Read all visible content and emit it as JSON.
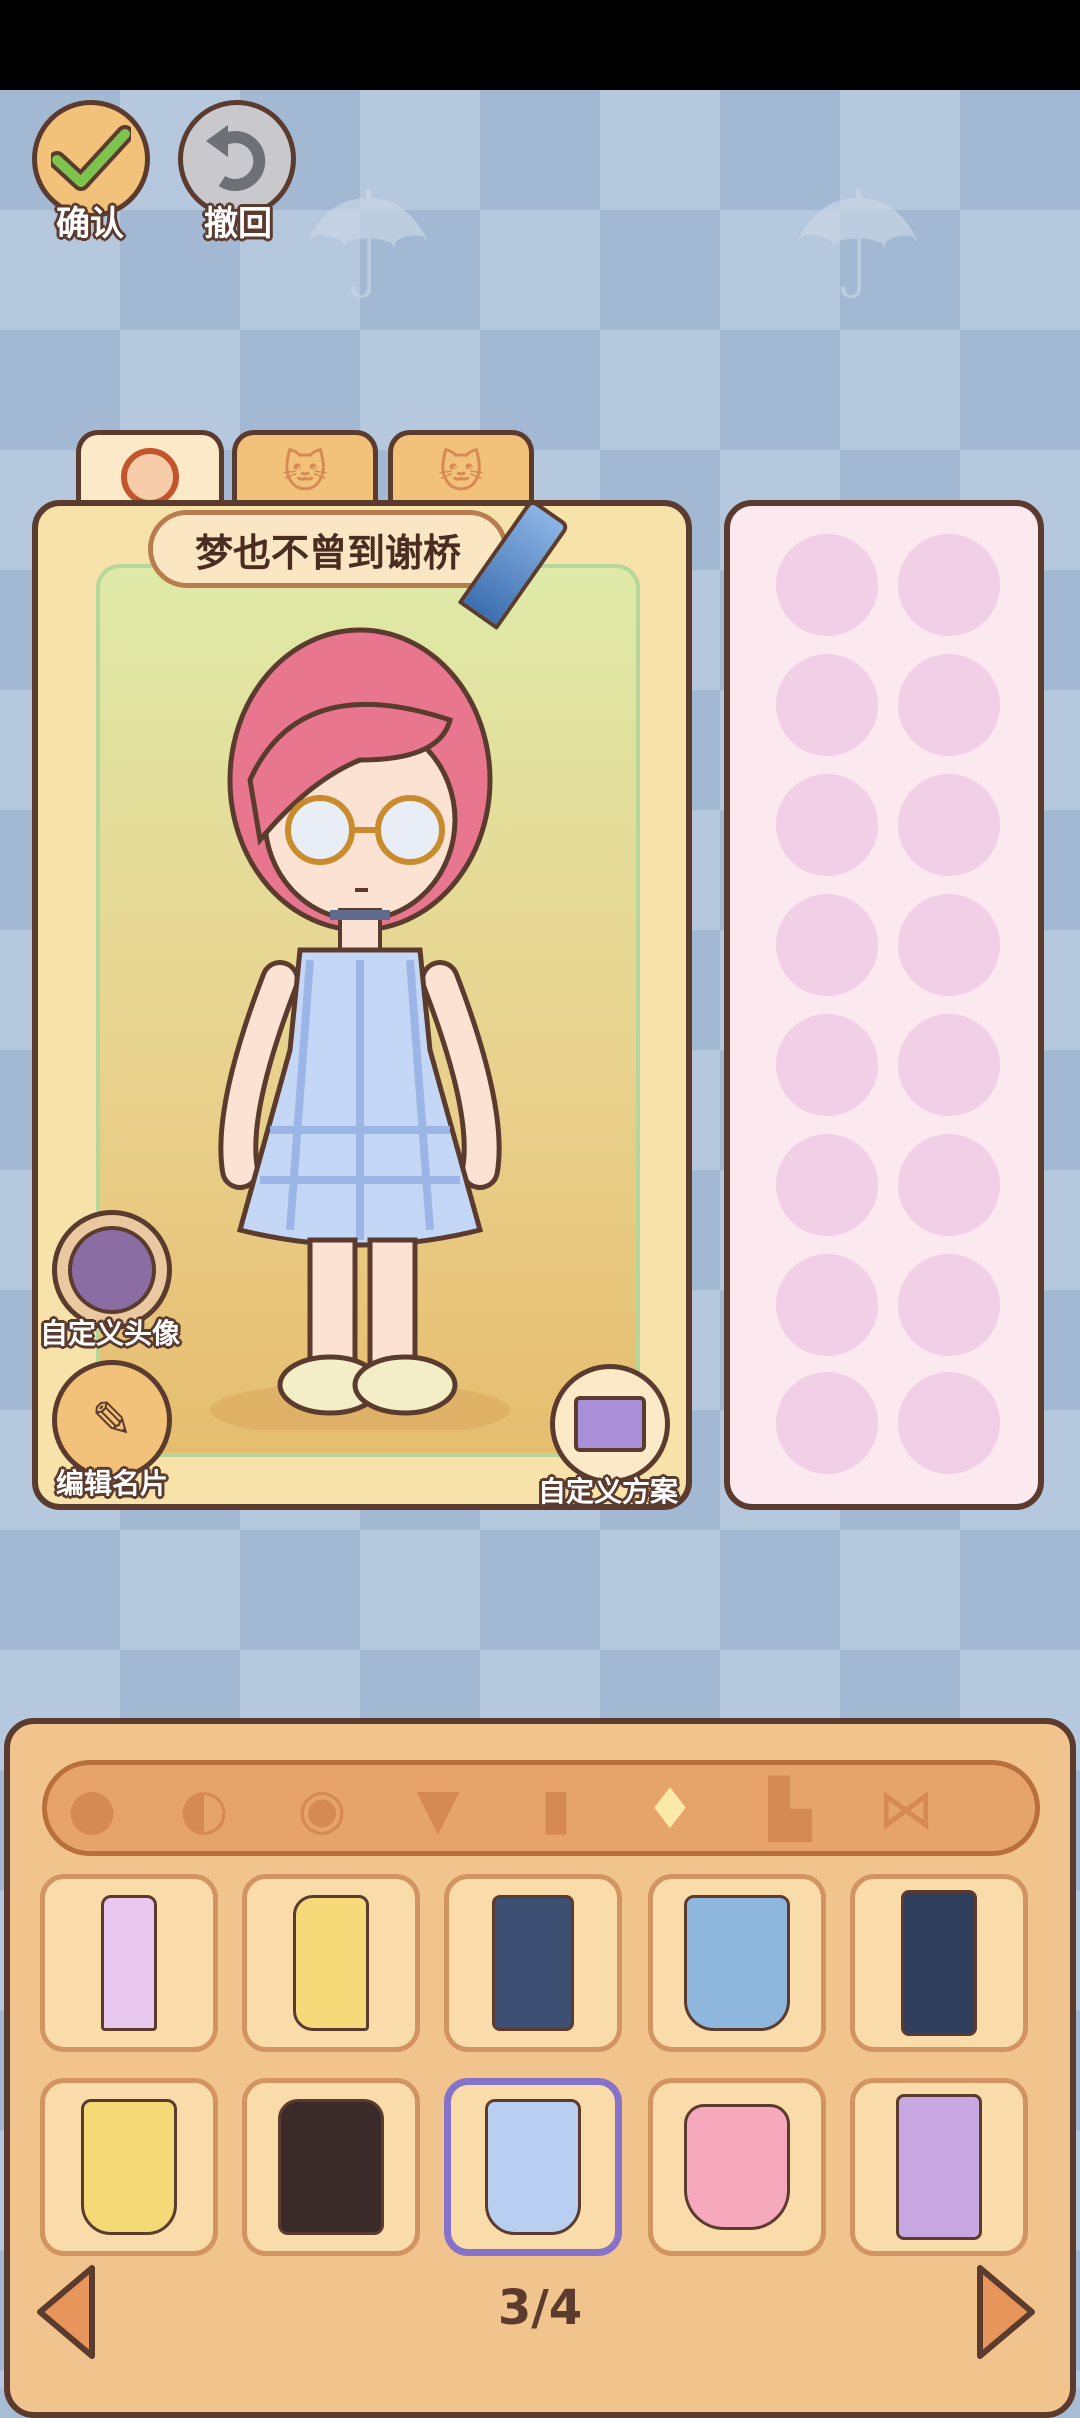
{
  "top_buttons": {
    "confirm_label": "确认",
    "undo_label": "撤回"
  },
  "profile_tabs": [
    {
      "icon": "girl-face-icon"
    },
    {
      "icon": "cat-face-icon"
    },
    {
      "icon": "cat-face-outline-icon"
    }
  ],
  "character": {
    "name": "梦也不曾到谢桥"
  },
  "card_actions": {
    "custom_avatar_label": "自定义头像",
    "edit_card_label": "编辑名片",
    "custom_scheme_label": "自定义方案"
  },
  "categories": [
    {
      "icon": "face-icon"
    },
    {
      "icon": "hair-icon"
    },
    {
      "icon": "eye-icon"
    },
    {
      "icon": "top-icon"
    },
    {
      "icon": "coat-icon"
    },
    {
      "icon": "outfit-icon",
      "active": true
    },
    {
      "icon": "shoe-icon"
    },
    {
      "icon": "bow-icon"
    }
  ],
  "items": [
    {
      "name": "purple-qipao",
      "color": "#e8c8ee"
    },
    {
      "name": "yellow-gown",
      "color": "#f6d979"
    },
    {
      "name": "navy-overalls",
      "color": "#3e4f74"
    },
    {
      "name": "denim-dress",
      "color": "#8fb7de"
    },
    {
      "name": "overall-pants",
      "color": "#2f3e5c"
    },
    {
      "name": "yellow-gingham-dress",
      "color": "#f4d977"
    },
    {
      "name": "black-dress",
      "color": "#3a2a2a"
    },
    {
      "name": "blue-gingham-dress",
      "color": "#b9cff2",
      "selected": true
    },
    {
      "name": "pink-dress",
      "color": "#f6a9bd"
    },
    {
      "name": "lavender-robe",
      "color": "#c7a8e2"
    }
  ],
  "pager": {
    "text": "3/4"
  },
  "colors": {
    "outline": "#5b3b2e",
    "panel_bg": "#f2c48d",
    "selected_border": "#8672c9"
  }
}
